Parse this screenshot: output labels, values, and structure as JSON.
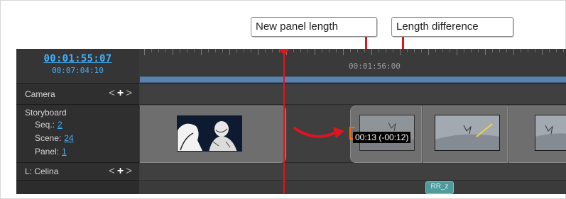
{
  "annotations": {
    "new_panel_length": "New panel length",
    "length_difference": "Length difference"
  },
  "timecode": {
    "current": "00:01:55:07",
    "total": "00:07:04:10"
  },
  "ruler": {
    "label": "00:01:56:00"
  },
  "tracks": {
    "camera": {
      "name": "Camera",
      "prev": "<",
      "add": "+",
      "next": ">"
    },
    "storyboard": {
      "name": "Storyboard",
      "seq_label": "Seq.:",
      "seq_value": "2",
      "scene_label": "Scene:",
      "scene_value": "24",
      "panel_label": "Panel:",
      "panel_value": "1"
    },
    "celina": {
      "name": "L: Celina",
      "prev": "<",
      "add": "+",
      "next": ">"
    }
  },
  "trim_readout": "00:13 (-00:12)",
  "bottom_badge": "RR_z",
  "colors": {
    "accent_timecode": "#3fb2ff",
    "playhead": "#e0141e",
    "ruler_bar": "#5a82ad",
    "trim_handle": "#ff6a00"
  },
  "icons": {
    "playhead": "playhead-marker-icon",
    "trim_handle": "trim-handle-icon",
    "move_arrow": "curved-arrow-icon"
  }
}
